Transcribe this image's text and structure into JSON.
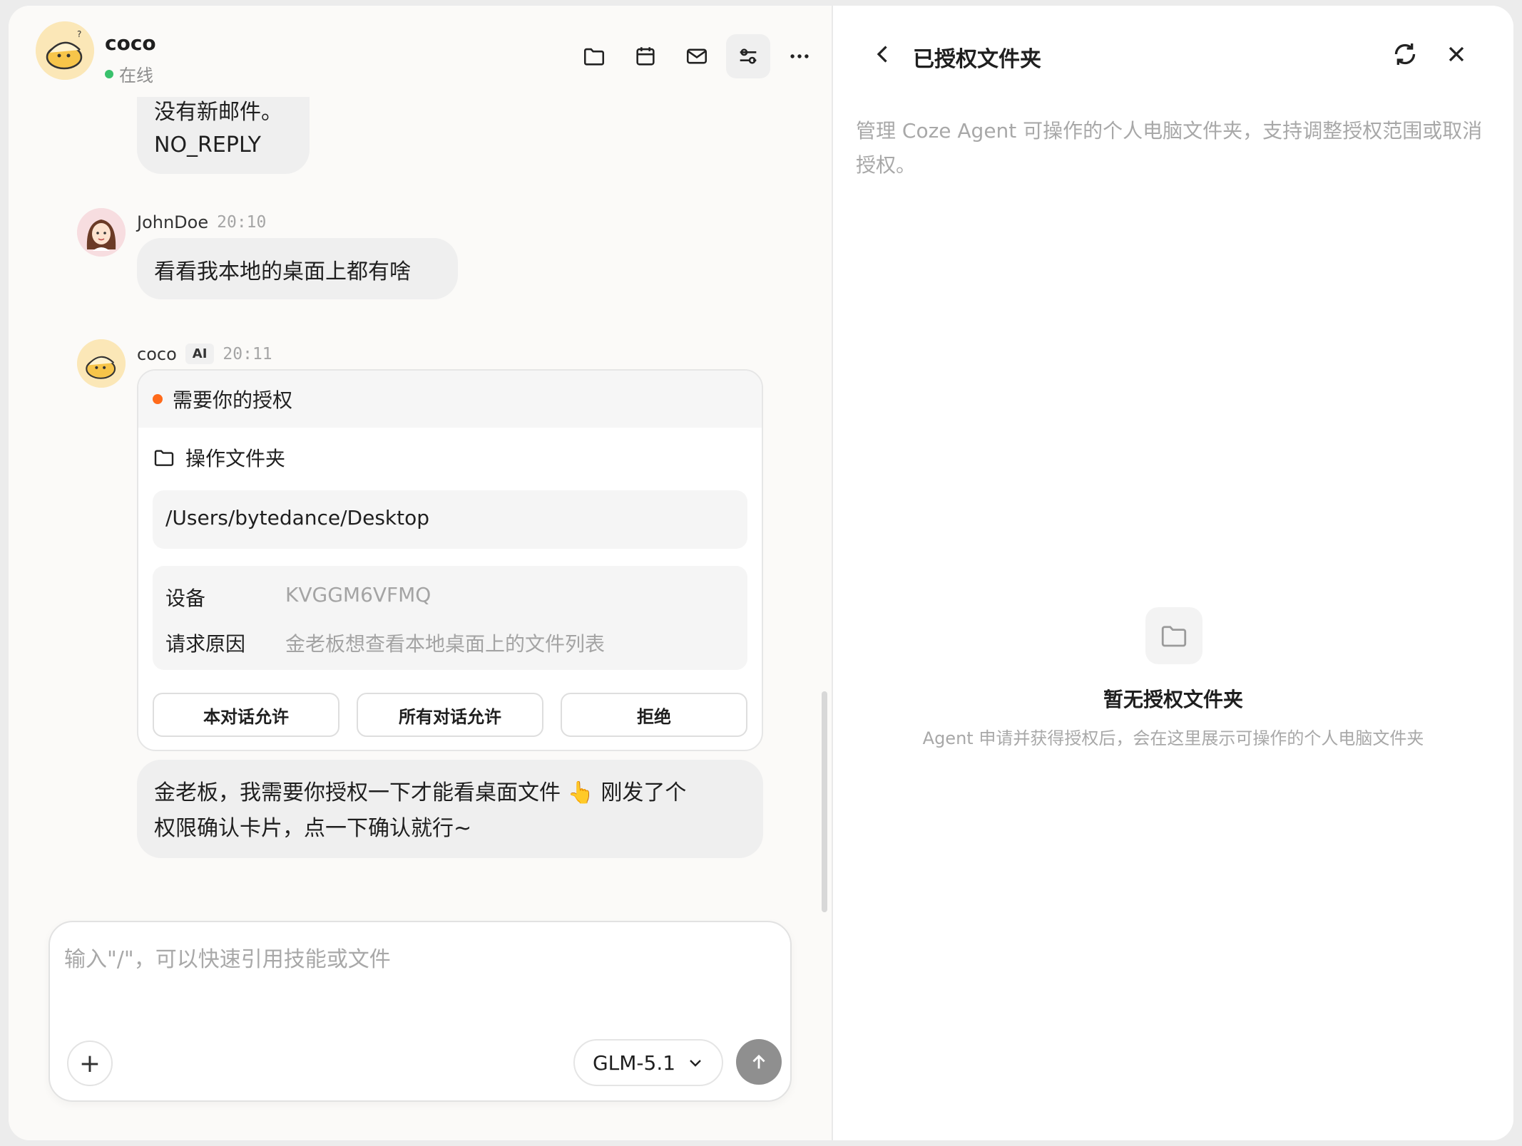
{
  "header": {
    "name": "coco",
    "status": "在线",
    "icons": [
      "folder-icon",
      "calendar-icon",
      "mail-icon",
      "settings-sliders-icon",
      "more-icon"
    ]
  },
  "messages": [
    {
      "sender": "coco",
      "text_partial": "没有新邮件。",
      "text": "NO_REPLY"
    },
    {
      "sender": "JohnDoe",
      "time": "20:10",
      "text": "看看我本地的桌面上都有啥"
    },
    {
      "sender": "coco",
      "tag": "AI",
      "time": "20:11",
      "card": {
        "title": "需要你的授权",
        "operation": "操作文件夹",
        "path": "/Users/bytedance/Desktop",
        "rows": [
          {
            "key": "设备",
            "value": "KVGGM6VFMQ"
          },
          {
            "key": "请求原因",
            "value": "金老板想查看本地桌面上的文件列表"
          }
        ],
        "buttons": [
          "本对话允许",
          "所有对话允许",
          "拒绝"
        ]
      },
      "text_line1": "金老板，我需要你授权一下才能看桌面文件 👆 刚发了个",
      "text_line2": "权限确认卡片，点一下确认就行~"
    }
  ],
  "composer": {
    "placeholder": "输入\"/\"，可以快速引用技能或文件",
    "add_label": "+",
    "model": "GLM-5.1"
  },
  "panel": {
    "title": "已授权文件夹",
    "description": "管理 Coze Agent 可操作的个人电脑文件夹，支持调整授权范围或取消授权。",
    "empty_title": "暂无授权文件夹",
    "empty_subtitle": "Agent 申请并获得授权后，会在这里展示可操作的个人电脑文件夹"
  },
  "colors": {
    "online": "#39c16c",
    "pending": "#ff6a1a",
    "bubble": "#efefef",
    "send": "#8f8f8f"
  }
}
